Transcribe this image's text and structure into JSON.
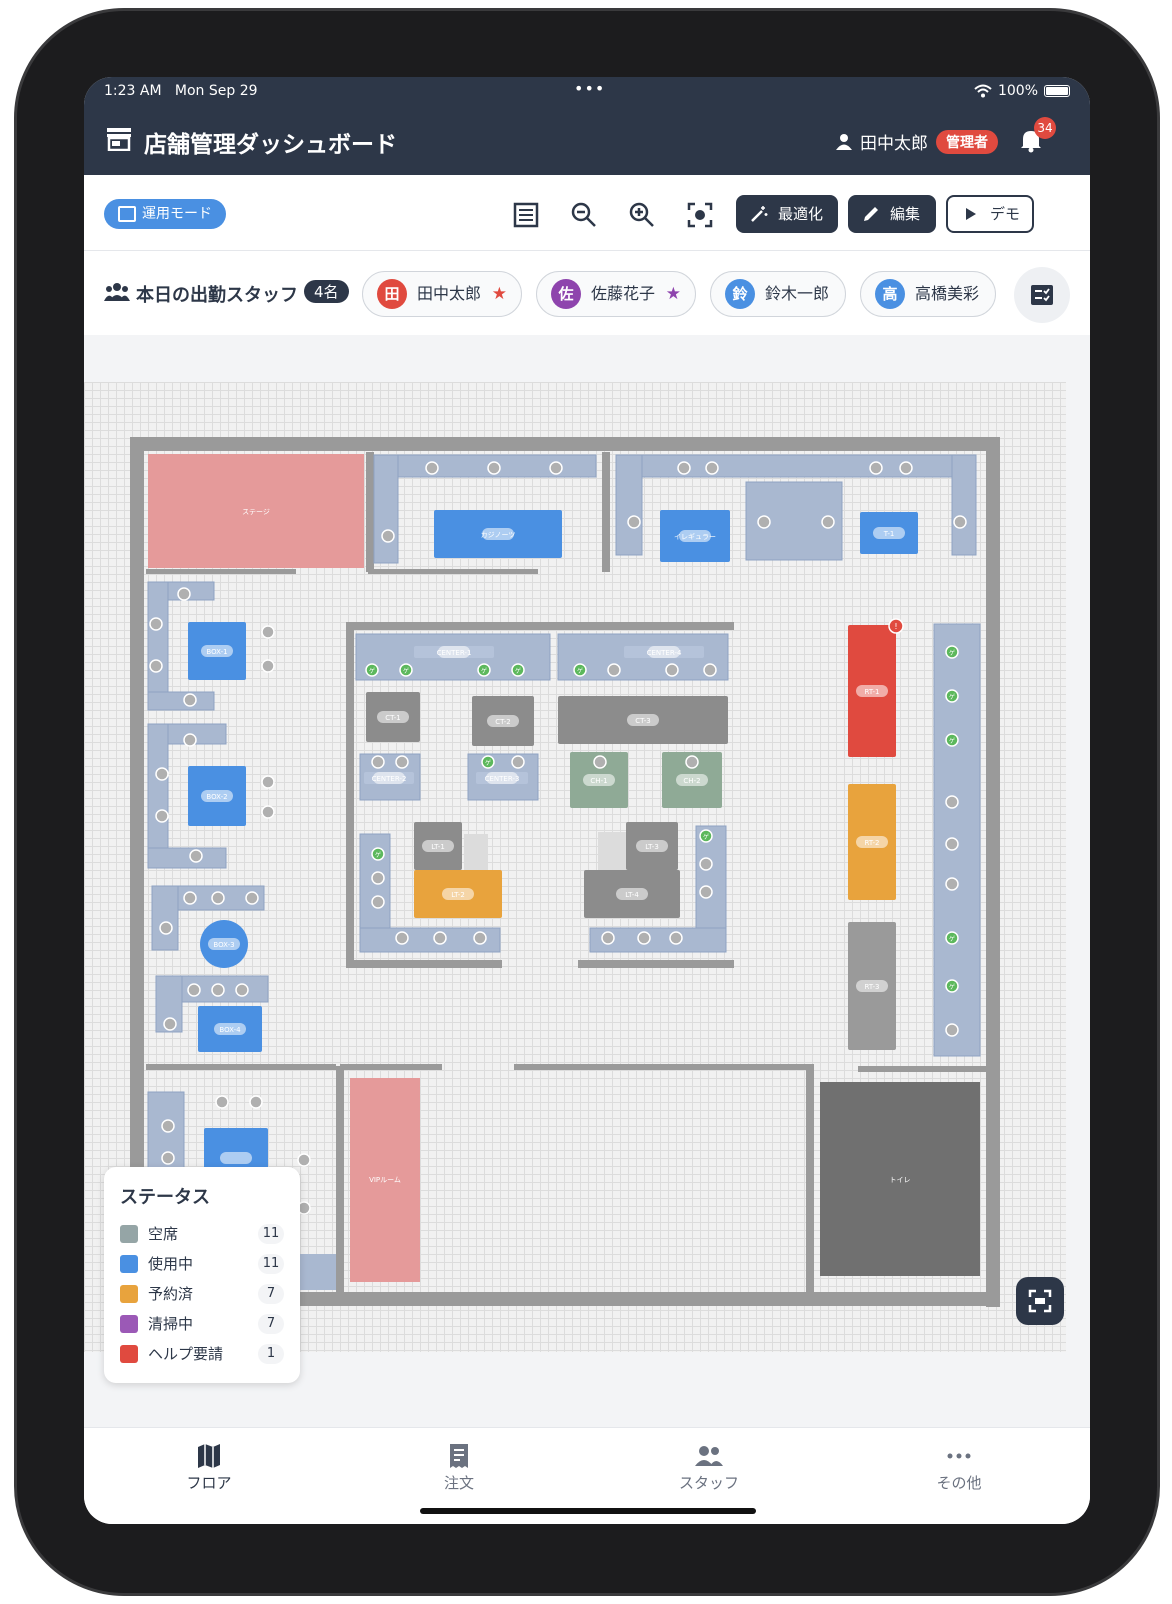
{
  "status_bar": {
    "time": "1:23 AM",
    "date": "Mon Sep 29",
    "dots": "•••",
    "battery": "100%"
  },
  "header": {
    "title": "店舗管理ダッシュボード",
    "user_name": "田中太郎",
    "role": "管理者",
    "notification_count": "34"
  },
  "toolbar": {
    "mode_label": "運用モード",
    "optimize_label": "最適化",
    "edit_label": "編集",
    "demo_label": "デモ"
  },
  "staff": {
    "label": "本日の出勤スタッフ",
    "count": "4名",
    "members": [
      {
        "initial": "田",
        "name": "田中太郎",
        "star": "★",
        "color": "#e04a3f",
        "star_color": "#e04a3f"
      },
      {
        "initial": "佐",
        "name": "佐藤花子",
        "star": "★",
        "color": "#8e44ad",
        "star_color": "#8e44ad"
      },
      {
        "initial": "鈴",
        "name": "鈴木一郎",
        "star": "",
        "color": "#4a90e2",
        "star_color": ""
      },
      {
        "initial": "高",
        "name": "高橋美彩",
        "star": "",
        "color": "#4a90e2",
        "star_color": ""
      }
    ]
  },
  "floor": {
    "areas": {
      "stage": "ステージ",
      "vip": "VIPルーム",
      "toilet": "トイレ"
    },
    "tables": {
      "casino": "カジノーツ",
      "irregular": "イレギュラー",
      "t1": "T-1",
      "box1": "BOX-1",
      "box2": "BOX-2",
      "box3": "BOX-3",
      "box4": "BOX-4",
      "center1": "CENTER-1",
      "center4": "CENTER-4",
      "center2": "CENTER-2",
      "center3": "CENTER-3",
      "ct1": "CT-1",
      "ct2": "CT-2",
      "ct3": "CT-3",
      "ch1": "CH-1",
      "ch2": "CH-2",
      "lt1": "LT-1",
      "lt2": "LT-2",
      "lt3": "LT-3",
      "lt4": "LT-4",
      "rt1": "RT-1",
      "rt2": "RT-2",
      "rt3": "RT-3"
    },
    "guest_mark": "ゲ",
    "alert_mark": "!"
  },
  "legend": {
    "title": "ステータス",
    "items": [
      {
        "label": "空席",
        "count": "11",
        "color": "#95a5a6"
      },
      {
        "label": "使用中",
        "count": "11",
        "color": "#4a90e2"
      },
      {
        "label": "予約済",
        "count": "7",
        "color": "#e8a33d"
      },
      {
        "label": "清掃中",
        "count": "7",
        "color": "#9b59b6"
      },
      {
        "label": "ヘルプ要請",
        "count": "1",
        "color": "#e04a3f"
      }
    ]
  },
  "tabs": [
    {
      "label": "フロア",
      "active": true
    },
    {
      "label": "注文",
      "active": false
    },
    {
      "label": "スタッフ",
      "active": false
    },
    {
      "label": "その他",
      "active": false
    }
  ],
  "colors": {
    "header": "#2d3748",
    "occupied": "#4a90e2",
    "reserved": "#e8a33d",
    "help": "#e04a3f",
    "vacant": "#8c8c8c",
    "bench": "#a9b8d0",
    "wall": "#9a9a9a",
    "stage": "#e59a9a",
    "guest": "#5cb85c"
  }
}
